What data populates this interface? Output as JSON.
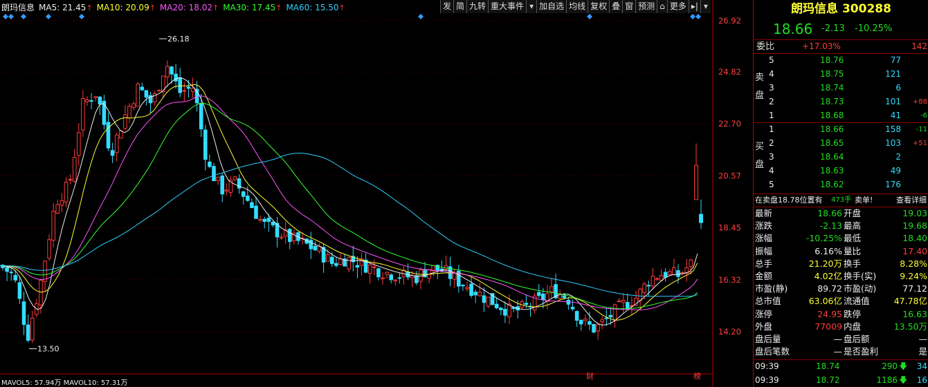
{
  "header": {
    "ma": [
      {
        "label": "朗玛信息",
        "color": "#eeeeee"
      },
      {
        "label": "MA5: 21.45",
        "color": "#eeeeee",
        "up": true
      },
      {
        "label": "MA10: 20.09",
        "color": "#ffff33",
        "up": true
      },
      {
        "label": "MA20: 18.02",
        "color": "#ff55ff",
        "up": true
      },
      {
        "label": "MA30: 17.45",
        "color": "#33ff33",
        "up": true
      },
      {
        "label": "MA60: 15.50",
        "color": "#33ccff",
        "up": true
      }
    ],
    "up_arrow": "↑"
  },
  "toolbar": [
    "发",
    "简",
    "九转",
    "重大事件",
    "▾",
    "加自选",
    "均线",
    "复权",
    "叠",
    "窗",
    "预测",
    "⌂",
    "更多",
    "▸|",
    "▾"
  ],
  "axis_labels": [
    "26.92",
    "24.82",
    "22.70",
    "20.57",
    "18.45",
    "16.32",
    "14.20"
  ],
  "annotations": {
    "high": "26.18",
    "low": "13.50",
    "cai": "财",
    "bang": "榜"
  },
  "bottom_ma": "MAVOL5: 57.94万  MAVOL10: 57.31万",
  "chart_data": {
    "type": "line",
    "title": "",
    "ylim": [
      12.5,
      27.2
    ],
    "y_ticks": [
      26.92,
      24.82,
      22.7,
      20.57,
      18.45,
      16.32,
      14.2
    ],
    "candles_note": "daily candles, approx",
    "ma_series": [
      {
        "name": "MA5",
        "color": "#eeeeee"
      },
      {
        "name": "MA10",
        "color": "#ffff33"
      },
      {
        "name": "MA20",
        "color": "#ff55ff"
      },
      {
        "name": "MA30",
        "color": "#33ff33"
      },
      {
        "name": "MA60",
        "color": "#33ccff"
      }
    ]
  },
  "quote": {
    "name": "朗玛信息",
    "code": "300288",
    "price": "18.66",
    "change": "-2.13",
    "pct": "-10.25%",
    "weibi_label": "委比",
    "weibi": "+17.03%",
    "weibi_val": "142",
    "sell_label": [
      "卖",
      "盘"
    ],
    "buy_label": [
      "买",
      "盘"
    ],
    "sell": [
      {
        "n": "5",
        "price": "18.76",
        "vol": "77",
        "chg": ""
      },
      {
        "n": "4",
        "price": "18.75",
        "vol": "121",
        "chg": ""
      },
      {
        "n": "3",
        "price": "18.74",
        "vol": "6",
        "chg": ""
      },
      {
        "n": "2",
        "price": "18.73",
        "vol": "101",
        "chg": "+88"
      },
      {
        "n": "1",
        "price": "18.68",
        "vol": "41",
        "chg": "-6"
      }
    ],
    "buy": [
      {
        "n": "1",
        "price": "18.66",
        "vol": "158",
        "chg": "-11"
      },
      {
        "n": "2",
        "price": "18.65",
        "vol": "103",
        "chg": "+51"
      },
      {
        "n": "3",
        "price": "18.64",
        "vol": "2",
        "chg": ""
      },
      {
        "n": "4",
        "price": "18.63",
        "vol": "49",
        "chg": ""
      },
      {
        "n": "5",
        "price": "18.62",
        "vol": "176",
        "chg": ""
      }
    ],
    "notice_a": "在卖盘18.78位置有",
    "notice_b": "473手",
    "notice_c": "卖单!",
    "notice_link": "查看详细",
    "stats": [
      {
        "l": "最新",
        "v": "18.66",
        "vc": "green",
        "l2": "开盘",
        "v2": "19.03",
        "vc2": "green"
      },
      {
        "l": "涨跌",
        "v": "-2.13",
        "vc": "green",
        "l2": "最高",
        "v2": "19.68",
        "vc2": "green"
      },
      {
        "l": "涨幅",
        "v": "-10.25%",
        "vc": "green",
        "l2": "最低",
        "v2": "18.40",
        "vc2": "green"
      },
      {
        "l": "振幅",
        "v": "6.16%",
        "vc": "white",
        "l2": "量比",
        "v2": "17.40",
        "vc2": "red"
      },
      {
        "l": "总手",
        "v": "21.20万",
        "vc": "yellow",
        "l2": "换手",
        "v2": "8.28%",
        "vc2": "yellow"
      },
      {
        "l": "金额",
        "v": "4.02亿",
        "vc": "yellow",
        "l2": "换手(实)",
        "v2": "9.24%",
        "vc2": "yellow"
      },
      {
        "l": "市盈(静)",
        "v": "89.72",
        "vc": "white",
        "l2": "市盈(动)",
        "v2": "77.12",
        "vc2": "white"
      },
      {
        "l": "总市值",
        "v": "63.06亿",
        "vc": "yellow",
        "l2": "流通值",
        "v2": "47.78亿",
        "vc2": "yellow"
      },
      {
        "l": "涨停",
        "v": "24.95",
        "vc": "red",
        "l2": "跌停",
        "v2": "16.63",
        "vc2": "green"
      },
      {
        "l": "外盘",
        "v": "77009",
        "vc": "red",
        "l2": "内盘",
        "v2": "13.50万",
        "vc2": "green"
      },
      {
        "l": "盘后量",
        "v": "—",
        "vc": "white",
        "l2": "盘后额",
        "v2": "—",
        "vc2": "white"
      },
      {
        "l": "盘后笔数",
        "v": "—",
        "vc": "white",
        "l2": "是否盈利",
        "v2": "是",
        "vc2": "white"
      }
    ],
    "ticks": [
      {
        "t": "09:39",
        "p": "18.74",
        "v": "290",
        "vc": "green",
        "n": "34"
      },
      {
        "t": "09:39",
        "p": "18.72",
        "v": "1186",
        "vc": "green",
        "n": "16"
      }
    ]
  }
}
